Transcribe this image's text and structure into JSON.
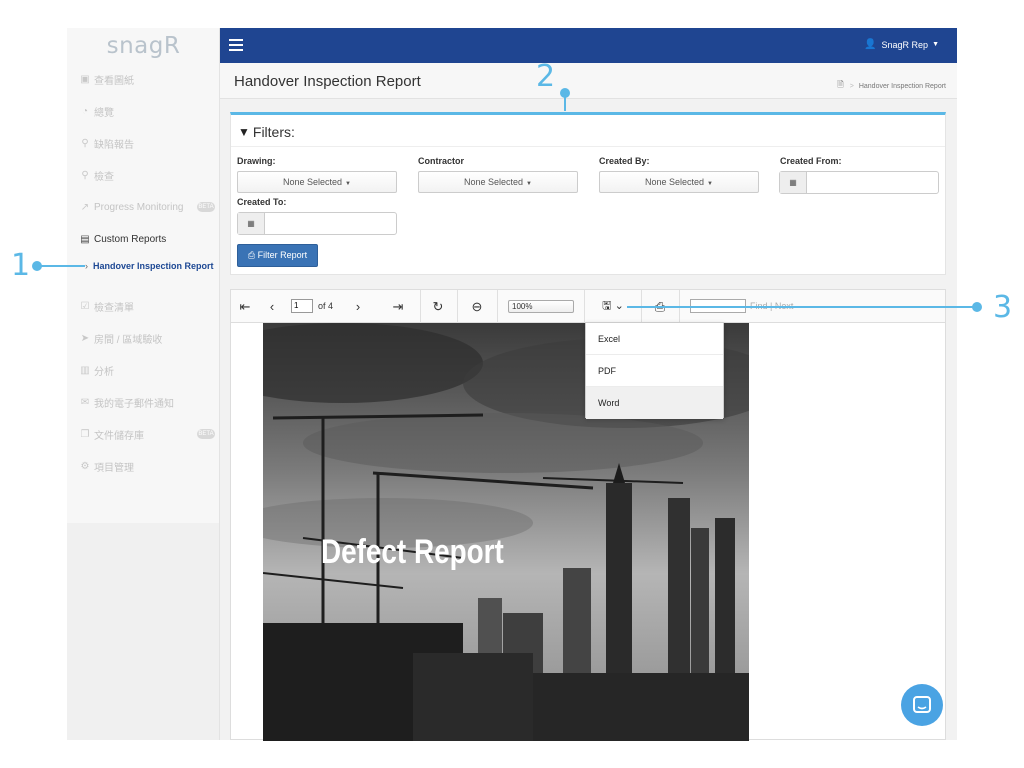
{
  "app": {
    "logo": "snagR",
    "user_name": "SnagR Rep"
  },
  "sidebar": {
    "items": [
      {
        "label": "查看圖紙",
        "icon": "image-icon",
        "glyph": "▣",
        "badge": ""
      },
      {
        "label": "總覽",
        "icon": "dashboard-icon",
        "glyph": "◔",
        "badge": ""
      },
      {
        "label": "缺陷報告",
        "icon": "map-pin-icon",
        "glyph": "⚲",
        "badge": ""
      },
      {
        "label": "檢查",
        "icon": "search-icon",
        "glyph": "⚲",
        "badge": ""
      },
      {
        "label": "Progress Monitoring",
        "icon": "line-chart-icon",
        "glyph": "↗",
        "badge": "BETA"
      },
      {
        "label": "Custom Reports",
        "icon": "document-icon",
        "glyph": "▤",
        "badge": ""
      },
      {
        "label": "檢查清單",
        "icon": "checklist-icon",
        "glyph": "☑",
        "badge": ""
      },
      {
        "label": "房間 / 區域驗收",
        "icon": "location-arrow-icon",
        "glyph": "➤",
        "badge": ""
      },
      {
        "label": "分析",
        "icon": "bar-chart-icon",
        "glyph": "▥",
        "badge": ""
      },
      {
        "label": "我的電子郵件通知",
        "icon": "envelope-icon",
        "glyph": "✉",
        "badge": ""
      },
      {
        "label": "文件儲存庫",
        "icon": "files-icon",
        "glyph": "❐",
        "badge": "BETA"
      },
      {
        "label": "項目管理",
        "icon": "cogs-icon",
        "glyph": "⚙",
        "badge": ""
      }
    ],
    "sub_item": "Handover Inspection Report"
  },
  "header": {
    "title": "Handover Inspection Report",
    "breadcrumb": "Handover Inspection Report"
  },
  "filters": {
    "title": "Filters:",
    "drawing_label": "Drawing:",
    "drawing_value": "None Selected",
    "contractor_label": "Contractor",
    "contractor_value": "None Selected",
    "created_by_label": "Created By:",
    "created_by_value": "None Selected",
    "created_from_label": "Created From:",
    "created_to_label": "Created To:",
    "button_label": "Filter Report"
  },
  "viewer": {
    "page_number": "1",
    "page_of": "of 4",
    "zoom": "100%",
    "find_next": "Find | Next",
    "report_title": "Defect Report",
    "export_options": [
      "Excel",
      "PDF",
      "Word"
    ]
  },
  "annotations": {
    "one": "1",
    "two": "2",
    "three": "3"
  },
  "colors": {
    "topbar": "#1f4591",
    "accent": "#5bb8e6",
    "button": "#3a73b5"
  }
}
